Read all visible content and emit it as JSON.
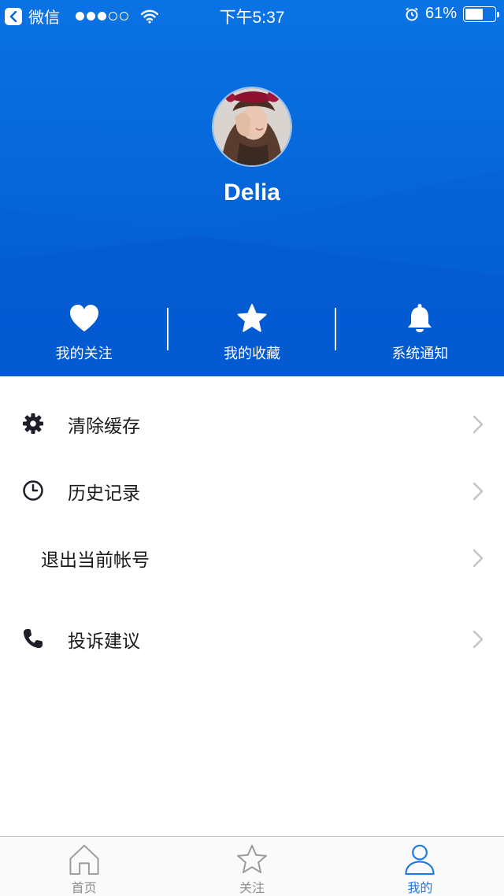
{
  "status_bar": {
    "back_label": "微信",
    "time": "下午5:37",
    "battery_text": "61%",
    "battery_level": 0.61,
    "signal_filled": 3,
    "signal_total": 5
  },
  "profile": {
    "username": "Delia"
  },
  "quick_actions": [
    {
      "label": "我的关注",
      "icon": "heart-icon"
    },
    {
      "label": "我的收藏",
      "icon": "star-icon"
    },
    {
      "label": "系统通知",
      "icon": "bell-icon"
    }
  ],
  "menu": [
    {
      "label": "清除缓存",
      "icon": "gear-icon"
    },
    {
      "label": "历史记录",
      "icon": "clock-icon"
    },
    {
      "label": "退出当前帐号",
      "icon": ""
    },
    {
      "label": "投诉建议",
      "icon": "phone-icon"
    }
  ],
  "tabbar": [
    {
      "label": "首页",
      "icon": "home-icon",
      "active": false
    },
    {
      "label": "关注",
      "icon": "star-outline-icon",
      "active": false
    },
    {
      "label": "我的",
      "icon": "user-icon",
      "active": true
    }
  ],
  "colors": {
    "header_blue": "#0564d8",
    "active_tab": "#1b7ae0",
    "inactive_tab": "#8e8e8e"
  }
}
